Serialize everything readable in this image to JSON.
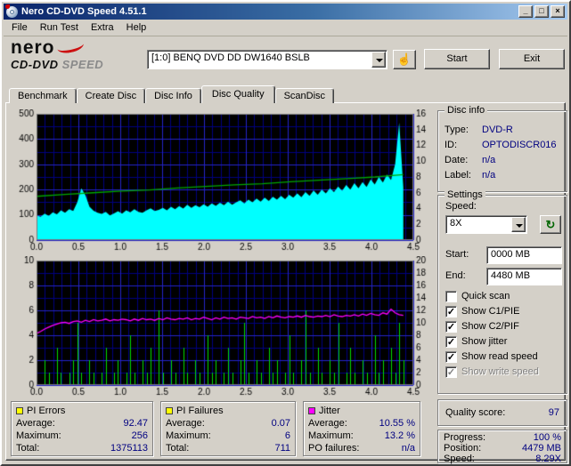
{
  "window": {
    "title": "Nero CD-DVD Speed 4.51.1",
    "controls": {
      "minimize": "_",
      "maximize": "□",
      "close": "×"
    }
  },
  "menu": {
    "items": [
      "File",
      "Run Test",
      "Extra",
      "Help"
    ]
  },
  "toolbar": {
    "logo": {
      "line1": "nero",
      "line2a": "CD-DVD",
      "line2b": "SPEED"
    },
    "drive_select": {
      "value": "[1:0]  BENQ DVD DD DW1640 BSLB"
    },
    "drive_button_icon": "☝",
    "refresh_icon": "↻",
    "start_button": "Start",
    "exit_button": "Exit"
  },
  "tabs": {
    "items": [
      "Benchmark",
      "Create Disc",
      "Disc Info",
      "Disc Quality",
      "ScanDisc"
    ],
    "active": "Disc Quality"
  },
  "disc_info": {
    "title": "Disc info",
    "rows": [
      {
        "label": "Type:",
        "value": "DVD-R"
      },
      {
        "label": "ID:",
        "value": "OPTODISCR016"
      },
      {
        "label": "Date:",
        "value": "n/a"
      },
      {
        "label": "Label:",
        "value": "n/a"
      }
    ]
  },
  "settings": {
    "title": "Settings",
    "speed_label": "Speed:",
    "speed_value": "8X",
    "start_label": "Start:",
    "start_value": "0000 MB",
    "end_label": "End:",
    "end_value": "4480 MB",
    "checkboxes": [
      {
        "label": "Quick scan",
        "glyph": "",
        "checked": false,
        "disabled": false
      },
      {
        "label": "Show C1/PIE",
        "glyph": "✓",
        "checked": true,
        "disabled": false
      },
      {
        "label": "Show C2/PIF",
        "glyph": "✓",
        "checked": true,
        "disabled": false
      },
      {
        "label": "Show jitter",
        "glyph": "✓",
        "checked": true,
        "disabled": false
      },
      {
        "label": "Show read speed",
        "glyph": "✓",
        "checked": true,
        "disabled": false
      },
      {
        "label": "Show write speed",
        "glyph": "✓",
        "checked": true,
        "disabled": true
      }
    ]
  },
  "quality": {
    "label": "Quality score:",
    "value": "97"
  },
  "progress": {
    "rows": [
      {
        "label": "Progress:",
        "value": "100 %"
      },
      {
        "label": "Position:",
        "value": "4479 MB"
      },
      {
        "label": "Speed:",
        "value": "8.29X"
      }
    ]
  },
  "stats": [
    {
      "name": "PI Errors",
      "color": "#ffff00",
      "rows": [
        [
          "Average:",
          "92.47"
        ],
        [
          "Maximum:",
          "256"
        ],
        [
          "Total:",
          "1375113"
        ]
      ]
    },
    {
      "name": "PI Failures",
      "color": "#ffff00",
      "rows": [
        [
          "Average:",
          "0.07"
        ],
        [
          "Maximum:",
          "6"
        ],
        [
          "Total:",
          "711"
        ]
      ]
    },
    {
      "name": "Jitter",
      "color": "#ff00ff",
      "rows": [
        [
          "Average:",
          "10.55 %"
        ],
        [
          "Maximum:",
          "13.2 %"
        ],
        [
          "PO failures:",
          "n/a"
        ]
      ]
    }
  ],
  "chart_data": [
    {
      "type": "area",
      "title": "PI Errors vs position (GB) with read speed",
      "x": {
        "min": 0,
        "max": 4.5,
        "minor": 0.1,
        "ticks": [
          [
            0,
            "0.0"
          ],
          [
            0.5,
            "0.5"
          ],
          [
            1,
            "1.0"
          ],
          [
            1.5,
            "1.5"
          ],
          [
            2,
            "2.0"
          ],
          [
            2.5,
            "2.5"
          ],
          [
            3,
            "3.0"
          ],
          [
            3.5,
            "3.5"
          ],
          [
            4,
            "4.0"
          ],
          [
            4.5,
            "4.5"
          ]
        ]
      },
      "left": {
        "min": 0,
        "max": 500,
        "minor": 50,
        "ticks": [
          [
            0,
            "0"
          ],
          [
            100,
            "100"
          ],
          [
            200,
            "200"
          ],
          [
            300,
            "300"
          ],
          [
            400,
            "400"
          ],
          [
            500,
            "500"
          ]
        ]
      },
      "right": {
        "min": 0,
        "max": 16,
        "ticks": [
          [
            0,
            "0"
          ],
          [
            2,
            "2"
          ],
          [
            4,
            "4"
          ],
          [
            6,
            "6"
          ],
          [
            8,
            "8"
          ],
          [
            10,
            "10"
          ],
          [
            12,
            "12"
          ],
          [
            14,
            "14"
          ],
          [
            16,
            "16"
          ]
        ]
      },
      "series": [
        {
          "name": "PI Errors (C1/PIE)",
          "kind": "area",
          "axis": "left",
          "color": "#00ffff",
          "x_span": [
            0,
            4.38
          ],
          "values": [
            98,
            92,
            105,
            96,
            110,
            102,
            118,
            108,
            122,
            115,
            150,
            205,
            178,
            132,
            116,
            108,
            104,
            112,
            98,
            106,
            114,
            105,
            118,
            110,
            122,
            112,
            108,
            118,
            126,
            115,
            120,
            128,
            118,
            132,
            122,
            135,
            125,
            140,
            128,
            138,
            130,
            142,
            132,
            145,
            136,
            148,
            138,
            152,
            140,
            150,
            158,
            145,
            160,
            150,
            165,
            152,
            168,
            155,
            172,
            160,
            175,
            162,
            180,
            168,
            185,
            170,
            190,
            175,
            196,
            180,
            200,
            185,
            205,
            190,
            212,
            195,
            218,
            200,
            225,
            205,
            230,
            210,
            240,
            220,
            250,
            228,
            260,
            238,
            300,
            465,
            210
          ]
        },
        {
          "name": "Read speed",
          "kind": "line",
          "axis": "right",
          "color": "#00a800",
          "x_span": [
            0,
            4.38
          ],
          "values": [
            5.55,
            5.8,
            6.0,
            6.2,
            6.35,
            6.6,
            6.8,
            7.0,
            7.15,
            7.4,
            7.6,
            7.8,
            8.0,
            8.29
          ]
        }
      ]
    },
    {
      "type": "line",
      "title": "PI Failures and Jitter vs position (GB)",
      "x": {
        "min": 0,
        "max": 4.5,
        "minor": 0.1,
        "ticks": [
          [
            0,
            "0.0"
          ],
          [
            0.5,
            "0.5"
          ],
          [
            1,
            "1.0"
          ],
          [
            1.5,
            "1.5"
          ],
          [
            2,
            "2.0"
          ],
          [
            2.5,
            "2.5"
          ],
          [
            3,
            "3.0"
          ],
          [
            3.5,
            "3.5"
          ],
          [
            4,
            "4.0"
          ],
          [
            4.5,
            "4.5"
          ]
        ]
      },
      "left": {
        "min": 0,
        "max": 10,
        "minor": 1,
        "ticks": [
          [
            0,
            "0"
          ],
          [
            2,
            "2"
          ],
          [
            4,
            "4"
          ],
          [
            6,
            "6"
          ],
          [
            8,
            "8"
          ],
          [
            10,
            "10"
          ]
        ]
      },
      "right": {
        "min": 0,
        "max": 20,
        "ticks": [
          [
            0,
            "0"
          ],
          [
            2,
            "2"
          ],
          [
            4,
            "4"
          ],
          [
            6,
            "6"
          ],
          [
            8,
            "8"
          ],
          [
            10,
            "10"
          ],
          [
            12,
            "12"
          ],
          [
            14,
            "14"
          ],
          [
            16,
            "16"
          ],
          [
            18,
            "18"
          ],
          [
            20,
            "20"
          ]
        ]
      },
      "series": [
        {
          "name": "PI Failures (C2/PIF)",
          "kind": "spikes",
          "axis": "left",
          "color": "#00dd00",
          "x_span": [
            0,
            4.38
          ],
          "values": [
            1,
            0,
            2,
            1,
            0,
            3,
            1,
            0,
            1,
            2,
            5,
            1,
            0,
            2,
            1,
            0,
            1,
            3,
            0,
            1,
            2,
            0,
            1,
            4,
            1,
            0,
            2,
            1,
            3,
            0,
            6,
            1,
            0,
            2,
            1,
            0,
            3,
            1,
            0,
            2,
            1,
            0,
            4,
            1,
            2,
            0,
            1,
            3,
            1,
            0,
            2,
            5,
            1,
            0,
            2,
            1,
            0,
            3,
            1,
            2,
            0,
            1,
            4,
            1,
            0,
            2,
            6,
            1,
            0,
            3,
            1,
            0,
            2,
            1,
            5,
            0,
            1,
            3,
            1,
            0,
            2,
            1,
            0,
            4,
            1,
            2,
            0,
            3,
            1,
            5,
            2
          ]
        },
        {
          "name": "Jitter",
          "kind": "line",
          "axis": "right",
          "color": "#ff00ff",
          "x_span": [
            0,
            4.38
          ],
          "values": [
            8.3,
            8.6,
            9.0,
            9.3,
            9.6,
            9.8,
            10.0,
            10.1,
            9.9,
            10.2,
            10.3,
            10.1,
            10.4,
            10.2,
            10.5,
            10.3,
            10.4,
            10.6,
            10.3,
            10.5,
            10.4,
            10.6,
            10.5,
            10.3,
            10.6,
            10.4,
            10.7,
            10.5,
            10.6,
            10.4,
            10.7,
            10.5,
            10.8,
            10.6,
            10.5,
            10.7,
            10.6,
            10.8,
            10.5,
            10.7,
            10.6,
            10.9,
            10.7,
            10.5,
            10.8,
            10.6,
            10.9,
            10.7,
            10.8,
            10.6,
            10.9,
            10.8,
            10.7,
            11.0,
            10.8,
            10.9,
            10.7,
            11.0,
            10.8,
            11.1,
            10.9,
            10.8,
            11.0,
            10.9,
            11.1,
            10.9,
            11.2,
            11.0,
            10.9,
            11.1,
            11.0,
            11.2,
            11.0,
            11.3,
            11.1,
            11.0,
            11.2,
            11.1,
            11.3,
            11.1,
            11.4,
            11.2,
            11.5,
            11.3,
            11.2,
            11.6,
            11.4,
            12.2,
            11.6,
            11.3,
            11.2
          ]
        }
      ]
    }
  ]
}
